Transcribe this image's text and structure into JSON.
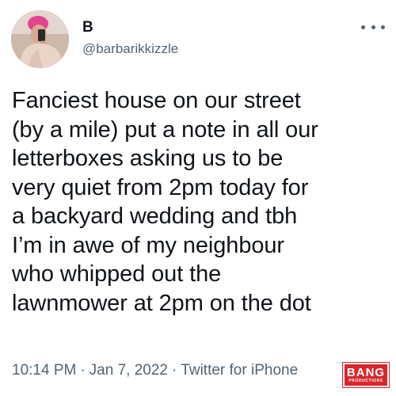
{
  "author": {
    "name": "B",
    "handle": "@barbarikkizzle",
    "avatar": "profile-photo"
  },
  "more_icon": "more-horizontal-icon",
  "tweet": {
    "lines": [
      "Fanciest house on our street",
      "(by a mile) put a note in all our",
      "letterboxes asking us to be",
      "very quiet from 2pm today for",
      "a backyard wedding and tbh",
      "I’m in awe of my neighbour",
      "who whipped out the",
      "lawnmower at 2pm on the dot"
    ]
  },
  "meta": {
    "time": "10:14 PM",
    "separator": "·",
    "date": "Jan 7, 2022",
    "client": "Twitter for iPhone"
  },
  "watermark": {
    "main": "BANG",
    "sub": "PRODUCTIONS",
    "color": "#d8262b"
  },
  "colors": {
    "text_primary": "#0f1419",
    "text_secondary": "#536471",
    "background": "#ffffff"
  }
}
